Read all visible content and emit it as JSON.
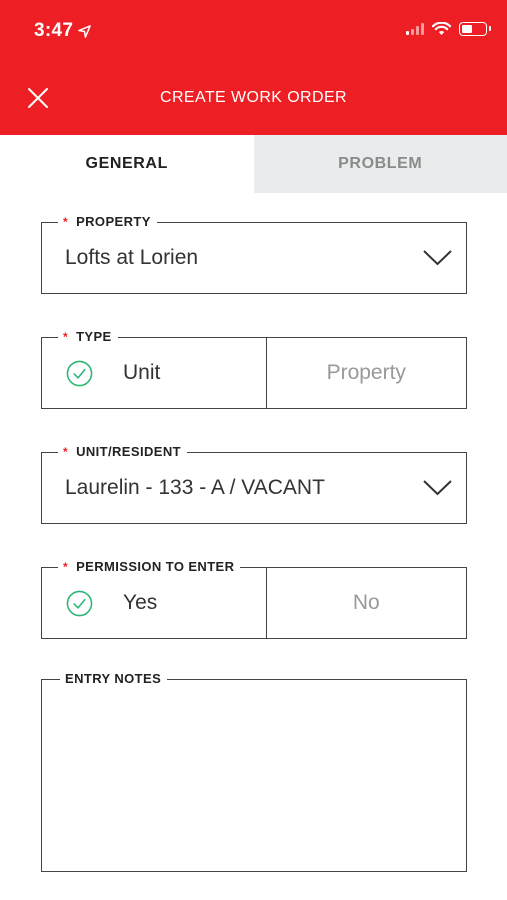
{
  "status_bar": {
    "time": "3:47",
    "location_icon": "location-arrow-icon",
    "signal_icon": "cellular-signal-icon",
    "wifi_icon": "wifi-icon",
    "battery_icon": "battery-icon"
  },
  "header": {
    "title": "CREATE WORK ORDER",
    "close_icon": "close-icon",
    "background": "#ed1f24"
  },
  "tabs": [
    {
      "label": "GENERAL",
      "active": true
    },
    {
      "label": "PROBLEM",
      "active": false
    }
  ],
  "form": {
    "property": {
      "label": "PROPERTY",
      "required": "*",
      "value": "Lofts at Lorien",
      "icon": "chevron-down-icon"
    },
    "type": {
      "label": "TYPE",
      "required": "*",
      "options": [
        "Unit",
        "Property"
      ],
      "selected": "Unit"
    },
    "unit_resident": {
      "label": "UNIT/RESIDENT",
      "required": "*",
      "value": "Laurelin - 133 - A / VACANT",
      "icon": "chevron-down-icon"
    },
    "permission": {
      "label": "PERMISSION TO ENTER",
      "required": "*",
      "options": [
        "Yes",
        "No"
      ],
      "selected": "Yes"
    },
    "entry_notes": {
      "label": "ENTRY NOTES",
      "value": ""
    }
  },
  "colors": {
    "accent": "#ed1f24",
    "check": "#2bb673",
    "tab_inactive_bg": "#e9ecec"
  }
}
